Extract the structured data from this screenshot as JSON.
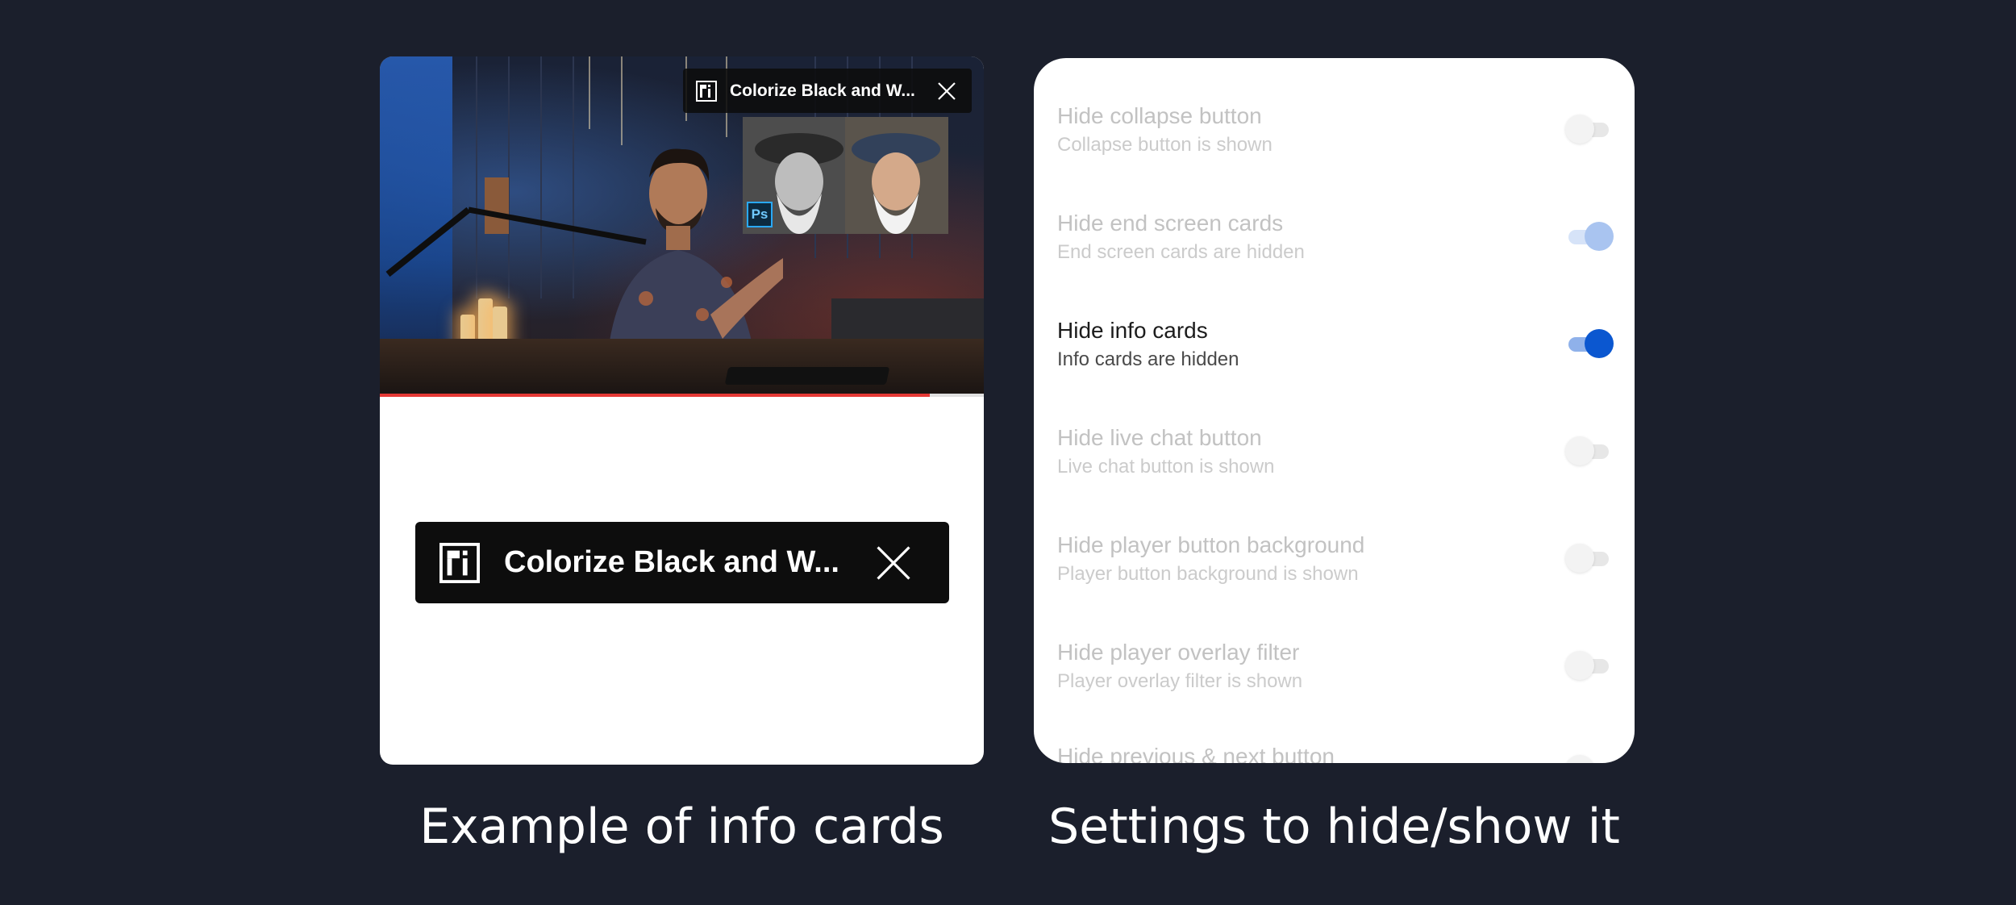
{
  "left_panel": {
    "mini_card_title": "Colorize Black and W...",
    "large_card_title": "Colorize Black and W...",
    "thumbnail_badge": "Ps",
    "progress": 0.91
  },
  "settings": [
    {
      "title": "Hide collapse button",
      "subtitle": "Collapse button is shown",
      "enabled": false,
      "on": false
    },
    {
      "title": "Hide end screen cards",
      "subtitle": "End screen cards are hidden",
      "enabled": false,
      "on": true
    },
    {
      "title": "Hide info cards",
      "subtitle": "Info cards are hidden",
      "enabled": true,
      "on": true
    },
    {
      "title": "Hide live chat button",
      "subtitle": "Live chat button is shown",
      "enabled": false,
      "on": false
    },
    {
      "title": "Hide player button background",
      "subtitle": "Player button background is shown",
      "enabled": false,
      "on": false
    },
    {
      "title": "Hide player overlay filter",
      "subtitle": "Player overlay filter is shown",
      "enabled": false,
      "on": false
    },
    {
      "title": "Hide previous & next button",
      "subtitle": "",
      "enabled": false,
      "on": false
    }
  ],
  "captions": {
    "left": "Example of info cards",
    "right": "Settings to hide/show it"
  },
  "colors": {
    "background": "#1b1f2c",
    "toggle_on": "#0b57d0",
    "progress": "#e53935"
  }
}
